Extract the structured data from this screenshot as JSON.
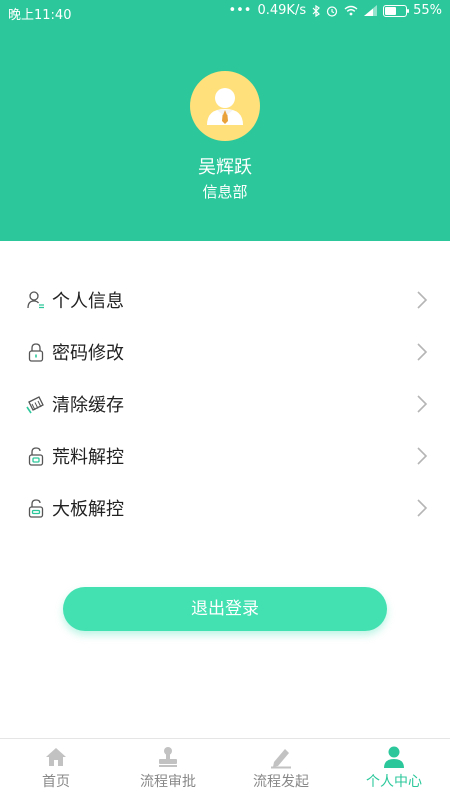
{
  "statusbar": {
    "time": "晚上11:40",
    "network_speed": "0.49K/s",
    "battery_percent": "55%",
    "battery_level": 0.55,
    "icons": [
      "more-dots-icon",
      "bluetooth-icon",
      "alarm-icon",
      "wifi-icon",
      "signal-icon",
      "battery-icon"
    ]
  },
  "profile": {
    "name": "吴辉跃",
    "department": "信息部",
    "avatar_icon": "user-avatar-icon"
  },
  "menu": {
    "items": [
      {
        "label": "个人信息",
        "icon": "user-info-icon"
      },
      {
        "label": "密码修改",
        "icon": "lock-icon"
      },
      {
        "label": "清除缓存",
        "icon": "broom-icon"
      },
      {
        "label": "荒料解控",
        "icon": "unlock-icon"
      },
      {
        "label": "大板解控",
        "icon": "unlock-icon"
      }
    ],
    "chevron_icon": "chevron-right-icon"
  },
  "logout_label": "退出登录",
  "tabbar": {
    "tabs": [
      {
        "label": "首页",
        "icon": "home-icon",
        "active": false
      },
      {
        "label": "流程审批",
        "icon": "stamp-icon",
        "active": false
      },
      {
        "label": "流程发起",
        "icon": "edit-icon",
        "active": false
      },
      {
        "label": "个人中心",
        "icon": "person-icon",
        "active": true
      }
    ]
  },
  "colors": {
    "brand": "#2cc89b",
    "button": "#43e0b1",
    "avatar_bg": "#ffe07a"
  }
}
